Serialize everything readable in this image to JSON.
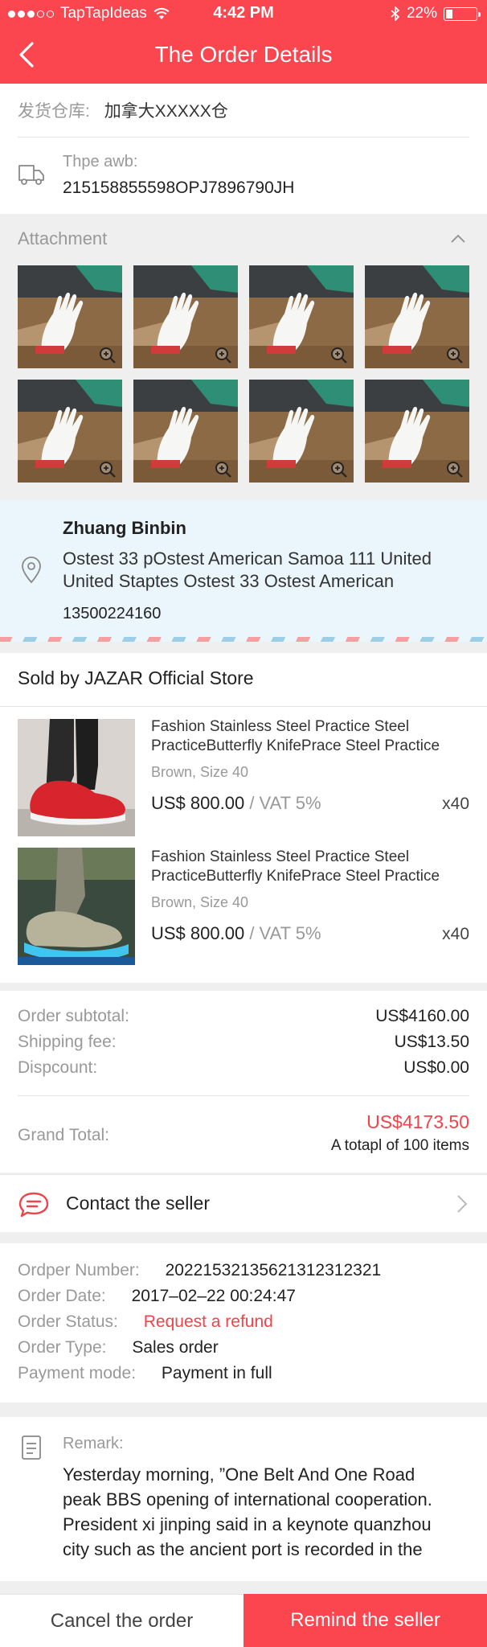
{
  "status_bar": {
    "carrier": "TapTapIdeas",
    "time": "4:42 PM",
    "battery": "22%",
    "battery_level": 0.22
  },
  "header": {
    "title": "The Order Details"
  },
  "shipping": {
    "warehouse_label": "发货仓库:",
    "warehouse_value": "加拿大XXXXX仓",
    "awb_label": "Thpe awb:",
    "awb_value": "215158855598OPJ7896790JH"
  },
  "attachment": {
    "label": "Attachment",
    "count": 8
  },
  "address": {
    "name": "Zhuang Binbin",
    "line1": "Ostest 33 pOstest American Samoa 111 United",
    "line2": "United Staptes Ostest 33 Ostest American",
    "phone": "13500224160"
  },
  "store": {
    "sold_by": "Sold by JAZAR Official Store"
  },
  "products": [
    {
      "title_line1": "Fashion Stainless Steel Practice Steel",
      "title_line2": "PracticeButterfly KnifePrace Steel Practice",
      "variant": "Brown,  Size 40",
      "price": "US$ 800.00",
      "vat": "/ VAT 5%",
      "qty": "x40"
    },
    {
      "title_line1": "Fashion Stainless Steel Practice Steel",
      "title_line2": "PracticeButterfly KnifePrace Steel Practice",
      "variant": "Brown,  Size 40",
      "price": "US$ 800.00",
      "vat": "/ VAT 5%",
      "qty": "x40"
    }
  ],
  "summary": {
    "subtotal_label": "Order subtotal:",
    "subtotal_value": "US$4160.00",
    "shipping_label": "Shipping fee:",
    "shipping_value": "US$13.50",
    "discount_label": "Dispcount:",
    "discount_value": "US$0.00",
    "grand_label": "Grand Total:",
    "grand_value": "US$4173.50",
    "items_note": "A totapl of 100 items"
  },
  "contact": {
    "label": "Contact the seller"
  },
  "order_info": {
    "number_label": "Ordper Number:",
    "number_value": "20221532135621312312321",
    "date_label": "Order Date:",
    "date_value": "2017–02–22 00:24:47",
    "status_label": "Order Status:",
    "status_value": "Request a refund",
    "type_label": "Order Type:",
    "type_value": "Sales order",
    "payment_label": "Payment mode:",
    "payment_value": "Payment in full"
  },
  "remark": {
    "label": "Remark:",
    "lines": [
      "Yesterday morning, ”One Belt And One Road",
      "peak BBS opening of international cooperation.",
      "President xi jinping said in a keynote quanzhou",
      "city such as the ancient port is recorded in the"
    ]
  },
  "actions": {
    "cancel": "Cancel the order",
    "remind": "Remind the seller"
  },
  "colors": {
    "brand_red": "#fb454f",
    "status_red": "#f0434b",
    "address_bg": "#eaf6fb"
  }
}
